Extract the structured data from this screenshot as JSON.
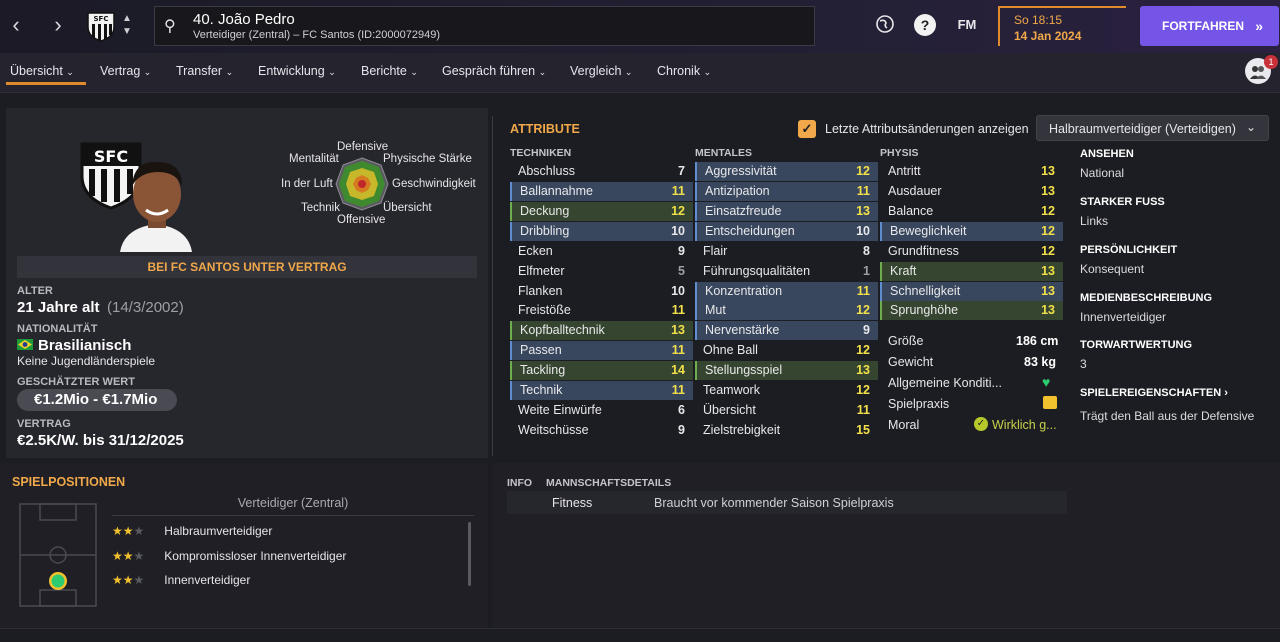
{
  "topbar": {
    "player_title": "40. João Pedro",
    "player_sub": "Verteidiger (Zentral) – FC Santos (ID:2000072949)",
    "fm_label": "FM",
    "date_time": "So 18:15",
    "date": "14 Jan 2024",
    "continue_label": "FORTFAHREN",
    "notification_count": "1",
    "accent": "#7554e8"
  },
  "menu": {
    "items": [
      "Übersicht",
      "Vertrag",
      "Transfer",
      "Entwicklung",
      "Berichte",
      "Gespräch führen",
      "Vergleich",
      "Chronik"
    ]
  },
  "profile": {
    "radar_labels": {
      "top": "Defensive",
      "tl": "Mentalität",
      "tr": "Physische Stärke",
      "l": "In der Luft",
      "r": "Geschwindigkeit",
      "bl": "Technik",
      "br": "Übersicht",
      "bottom": "Offensive"
    },
    "contract_banner": "BEI FC SANTOS UNTER VERTRAG",
    "age_label": "ALTER",
    "age_value": "21 Jahre alt",
    "dob": "(14/3/2002)",
    "nationality_label": "NATIONALITÄT",
    "nationality": "Brasilianisch",
    "youth_note": "Keine Jugendländerspiele",
    "value_label": "GESCHÄTZTER WERT",
    "value": "€1.2Mio - €1.7Mio",
    "contract_label": "VERTRAG",
    "contract": "€2.5K/W. bis 31/12/2025"
  },
  "attributes": {
    "title": "ATTRIBUTE",
    "toggle_label": "Letzte Attributsänderungen anzeigen",
    "role_select": "Halbraumverteidiger (Verteidigen)",
    "technical_header": "TECHNIKEN",
    "mental_header": "MENTALES",
    "physical_header": "PHYSIS",
    "technical": [
      {
        "name": "Abschluss",
        "value": "7",
        "hl": "none"
      },
      {
        "name": "Ballannahme",
        "value": "11",
        "hl": "blue"
      },
      {
        "name": "Deckung",
        "value": "12",
        "hl": "green"
      },
      {
        "name": "Dribbling",
        "value": "10",
        "hl": "blue"
      },
      {
        "name": "Ecken",
        "value": "9",
        "hl": "none"
      },
      {
        "name": "Elfmeter",
        "value": "5",
        "hl": "none"
      },
      {
        "name": "Flanken",
        "value": "10",
        "hl": "none"
      },
      {
        "name": "Freistöße",
        "value": "11",
        "hl": "none"
      },
      {
        "name": "Kopfballtechnik",
        "value": "13",
        "hl": "green"
      },
      {
        "name": "Passen",
        "value": "11",
        "hl": "blue"
      },
      {
        "name": "Tackling",
        "value": "14",
        "hl": "green"
      },
      {
        "name": "Technik",
        "value": "11",
        "hl": "blue"
      },
      {
        "name": "Weite Einwürfe",
        "value": "6",
        "hl": "none"
      },
      {
        "name": "Weitschüsse",
        "value": "9",
        "hl": "none"
      }
    ],
    "mental": [
      {
        "name": "Aggressivität",
        "value": "12",
        "hl": "blue"
      },
      {
        "name": "Antizipation",
        "value": "11",
        "hl": "blue"
      },
      {
        "name": "Einsatzfreude",
        "value": "13",
        "hl": "blue"
      },
      {
        "name": "Entscheidungen",
        "value": "10",
        "hl": "blue"
      },
      {
        "name": "Flair",
        "value": "8",
        "hl": "none"
      },
      {
        "name": "Führungsqualitäten",
        "value": "1",
        "hl": "none"
      },
      {
        "name": "Konzentration",
        "value": "11",
        "hl": "blue"
      },
      {
        "name": "Mut",
        "value": "12",
        "hl": "blue"
      },
      {
        "name": "Nervenstärke",
        "value": "9",
        "hl": "blue"
      },
      {
        "name": "Ohne Ball",
        "value": "12",
        "hl": "none"
      },
      {
        "name": "Stellungsspiel",
        "value": "13",
        "hl": "green"
      },
      {
        "name": "Teamwork",
        "value": "12",
        "hl": "none"
      },
      {
        "name": "Übersicht",
        "value": "11",
        "hl": "none"
      },
      {
        "name": "Zielstrebigkeit",
        "value": "15",
        "hl": "none"
      }
    ],
    "physical": [
      {
        "name": "Antritt",
        "value": "13",
        "hl": "none"
      },
      {
        "name": "Ausdauer",
        "value": "13",
        "hl": "none"
      },
      {
        "name": "Balance",
        "value": "12",
        "hl": "none"
      },
      {
        "name": "Beweglichkeit",
        "value": "12",
        "hl": "blue"
      },
      {
        "name": "Grundfitness",
        "value": "12",
        "hl": "none"
      },
      {
        "name": "Kraft",
        "value": "13",
        "hl": "green"
      },
      {
        "name": "Schnelligkeit",
        "value": "13",
        "hl": "blue"
      },
      {
        "name": "Sprunghöhe",
        "value": "13",
        "hl": "green"
      }
    ],
    "extra": {
      "height_label": "Größe",
      "height": "186 cm",
      "weight_label": "Gewicht",
      "weight": "83 kg",
      "condition_label": "Allgemeine Konditi...",
      "practice_label": "Spielpraxis",
      "morale_label": "Moral",
      "morale": "Wirklich g..."
    }
  },
  "info": {
    "reputation_label": "ANSEHEN",
    "reputation": "National",
    "foot_label": "STARKER FUSS",
    "foot": "Links",
    "personality_label": "PERSÖNLICHKEIT",
    "personality": "Konsequent",
    "media_label": "MEDIENBESCHREIBUNG",
    "media": "Innenverteidiger",
    "gk_label": "TORWARTWERTUNG",
    "gk": "3",
    "traits_label": "SPIELEREIGENSCHAFTEN",
    "traits": "Trägt den Ball aus der Defensive"
  },
  "positions": {
    "title": "SPIELPOSITIONEN",
    "subtitle": "Verteidiger (Zentral)",
    "roles": [
      {
        "name": "Halbraumverteidiger",
        "stars": 2
      },
      {
        "name": "Kompromissloser Innenverteidiger",
        "stars": 2
      },
      {
        "name": "Innenverteidiger",
        "stars": 2
      }
    ]
  },
  "team": {
    "tab_info": "INFO",
    "tab_team": "MANNSCHAFTSDETAILS",
    "fitness_label": "Fitness",
    "fitness_value": "Braucht vor kommender Saison Spielpraxis"
  }
}
